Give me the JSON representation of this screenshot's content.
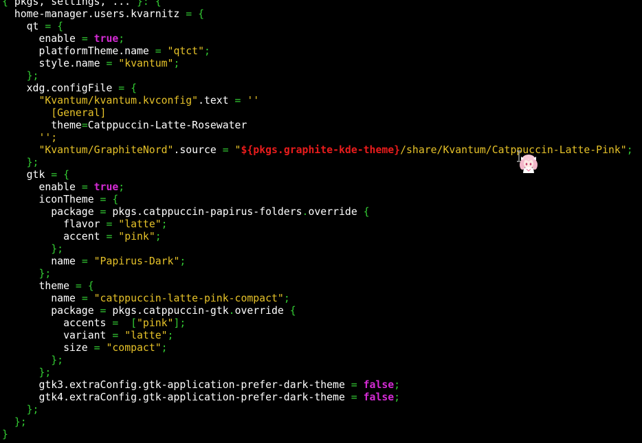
{
  "editor": {
    "colors": {
      "background": "#000000",
      "default_text": "#ffffff",
      "punctuation": "#33cc33",
      "keyword": "#d42bd4",
      "string": "#e6c229",
      "interpolation": "#e81c1c"
    },
    "lines": [
      [
        [
          "punct",
          "{ "
        ],
        [
          "text",
          "pkgs, settings, ... "
        ],
        [
          "punct",
          "}: {"
        ]
      ],
      [
        [
          "text",
          "  home-manager.users.kvarnitz "
        ],
        [
          "punct",
          "= {"
        ]
      ],
      [
        [
          "text",
          "    qt "
        ],
        [
          "punct",
          "= {"
        ]
      ],
      [
        [
          "text",
          "      enable "
        ],
        [
          "punct",
          "= "
        ],
        [
          "kw",
          "true"
        ],
        [
          "punct",
          ";"
        ]
      ],
      [
        [
          "text",
          "      platformTheme.name "
        ],
        [
          "punct",
          "= "
        ],
        [
          "str",
          "\"qtct\""
        ],
        [
          "punct",
          ";"
        ]
      ],
      [
        [
          "text",
          "      style.name "
        ],
        [
          "punct",
          "= "
        ],
        [
          "str",
          "\"kvantum\""
        ],
        [
          "punct",
          ";"
        ]
      ],
      [
        [
          "punct",
          "    };"
        ]
      ],
      [
        [
          "text",
          "    xdg.configFile "
        ],
        [
          "punct",
          "= {"
        ]
      ],
      [
        [
          "str",
          "      \"Kvantum/kvantum.kvconfig\""
        ],
        [
          "text",
          ".text "
        ],
        [
          "punct",
          "= "
        ],
        [
          "str",
          "''"
        ]
      ],
      [
        [
          "str",
          "        [General]"
        ]
      ],
      [
        [
          "text",
          "        theme"
        ],
        [
          "punct",
          "="
        ],
        [
          "text",
          "Catppuccin-Latte-Rosewater"
        ]
      ],
      [
        [
          "str",
          "      '';"
        ]
      ],
      [
        [
          "str",
          "      \"Kvantum/GraphiteNord\""
        ],
        [
          "text",
          ".source "
        ],
        [
          "punct",
          "= "
        ],
        [
          "str",
          "\""
        ],
        [
          "interp",
          "${pkgs.graphite-kde-theme}"
        ],
        [
          "str",
          "/share/Kvantum/Catppuccin-Latte-Pink\""
        ],
        [
          "punct",
          ";"
        ]
      ],
      [
        [
          "punct",
          "    };"
        ]
      ],
      [
        [
          "text",
          "    gtk "
        ],
        [
          "punct",
          "= {"
        ]
      ],
      [
        [
          "text",
          "      enable "
        ],
        [
          "punct",
          "= "
        ],
        [
          "kw",
          "true"
        ],
        [
          "punct",
          ";"
        ]
      ],
      [
        [
          "text",
          "      iconTheme "
        ],
        [
          "punct",
          "= {"
        ]
      ],
      [
        [
          "text",
          "        package "
        ],
        [
          "punct",
          "= "
        ],
        [
          "text",
          "pkgs.catppuccin-papirus-folders"
        ],
        [
          "punct",
          "."
        ],
        [
          "text",
          "override "
        ],
        [
          "punct",
          "{"
        ]
      ],
      [
        [
          "text",
          "          flavor "
        ],
        [
          "punct",
          "= "
        ],
        [
          "str",
          "\"latte\""
        ],
        [
          "punct",
          ";"
        ]
      ],
      [
        [
          "text",
          "          accent "
        ],
        [
          "punct",
          "= "
        ],
        [
          "str",
          "\"pink\""
        ],
        [
          "punct",
          ";"
        ]
      ],
      [
        [
          "punct",
          "        };"
        ]
      ],
      [
        [
          "text",
          "        name "
        ],
        [
          "punct",
          "= "
        ],
        [
          "str",
          "\"Papirus-Dark\""
        ],
        [
          "punct",
          ";"
        ]
      ],
      [
        [
          "punct",
          "      };"
        ]
      ],
      [
        [
          "text",
          "      theme "
        ],
        [
          "punct",
          "= {"
        ]
      ],
      [
        [
          "text",
          "        name "
        ],
        [
          "punct",
          "= "
        ],
        [
          "str",
          "\"catppuccin-latte-pink-compact\""
        ],
        [
          "punct",
          ";"
        ]
      ],
      [
        [
          "text",
          "        package "
        ],
        [
          "punct",
          "= "
        ],
        [
          "text",
          "pkgs.catppuccin-gtk"
        ],
        [
          "punct",
          "."
        ],
        [
          "text",
          "override "
        ],
        [
          "punct",
          "{"
        ]
      ],
      [
        [
          "text",
          "          accents "
        ],
        [
          "punct",
          "=  ["
        ],
        [
          "str",
          "\"pink\""
        ],
        [
          "punct",
          "];"
        ]
      ],
      [
        [
          "text",
          "          variant "
        ],
        [
          "punct",
          "= "
        ],
        [
          "str",
          "\"latte\""
        ],
        [
          "punct",
          ";"
        ]
      ],
      [
        [
          "text",
          "          size "
        ],
        [
          "punct",
          "= "
        ],
        [
          "str",
          "\"compact\""
        ],
        [
          "punct",
          ";"
        ]
      ],
      [
        [
          "punct",
          "        };"
        ]
      ],
      [
        [
          "punct",
          "      };"
        ]
      ],
      [
        [
          "text",
          "      gtk3.extraConfig.gtk-application-prefer-dark-theme "
        ],
        [
          "punct",
          "= "
        ],
        [
          "kw",
          "false"
        ],
        [
          "punct",
          ";"
        ]
      ],
      [
        [
          "text",
          "      gtk4.extraConfig.gtk-application-prefer-dark-theme "
        ],
        [
          "punct",
          "= "
        ],
        [
          "kw",
          "false"
        ],
        [
          "punct",
          ";"
        ]
      ],
      [
        [
          "punct",
          "    };"
        ]
      ],
      [
        [
          "punct",
          "  };"
        ]
      ],
      [
        [
          "punct",
          "}"
        ]
      ]
    ]
  },
  "overlays": {
    "mascot_icon": "anime-girl-mascot-icon",
    "cursor_icon": "text-cursor-ibeam-icon"
  }
}
